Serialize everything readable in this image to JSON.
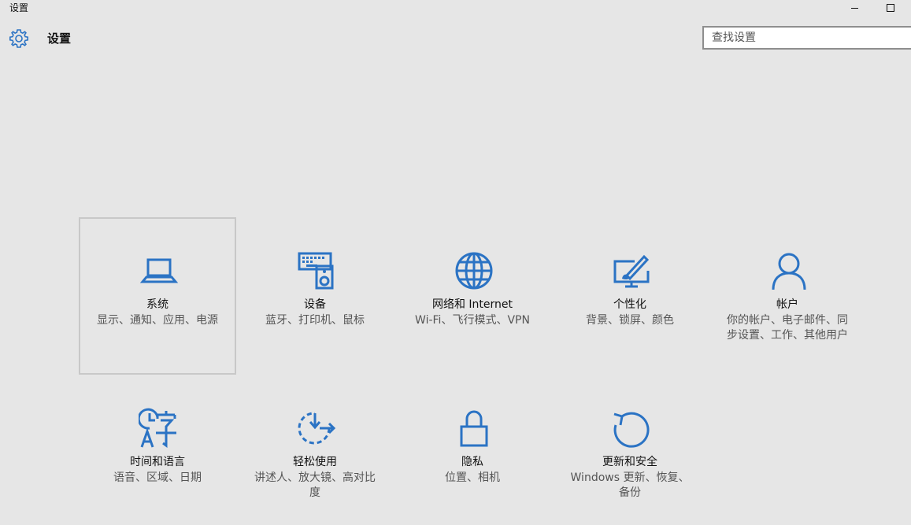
{
  "window": {
    "title": "设置"
  },
  "header": {
    "app_title": "设置"
  },
  "search": {
    "placeholder": "查找设置"
  },
  "tiles": [
    {
      "label": "系统",
      "desc": "显示、通知、应用、电源",
      "icon": "laptop-icon"
    },
    {
      "label": "设备",
      "desc": "蓝牙、打印机、鼠标",
      "icon": "keyboard-speaker-icon"
    },
    {
      "label": "网络和 Internet",
      "desc": "Wi-Fi、飞行模式、VPN",
      "icon": "globe-icon"
    },
    {
      "label": "个性化",
      "desc": "背景、锁屏、颜色",
      "icon": "paint-monitor-icon"
    },
    {
      "label": "帐户",
      "desc": "你的帐户、电子邮件、同步设置、工作、其他用户",
      "icon": "person-icon"
    },
    {
      "label": "时间和语言",
      "desc": "语音、区域、日期",
      "icon": "clock-language-icon"
    },
    {
      "label": "轻松使用",
      "desc": "讲述人、放大镜、高对比度",
      "icon": "ease-of-access-icon"
    },
    {
      "label": "隐私",
      "desc": "位置、相机",
      "icon": "lock-icon"
    },
    {
      "label": "更新和安全",
      "desc": "Windows 更新、恢复、备份",
      "icon": "refresh-icon"
    }
  ],
  "colors": {
    "accent": "#2b73c4",
    "background": "#e6e6e6",
    "selection_border": "#c8c8c8"
  }
}
